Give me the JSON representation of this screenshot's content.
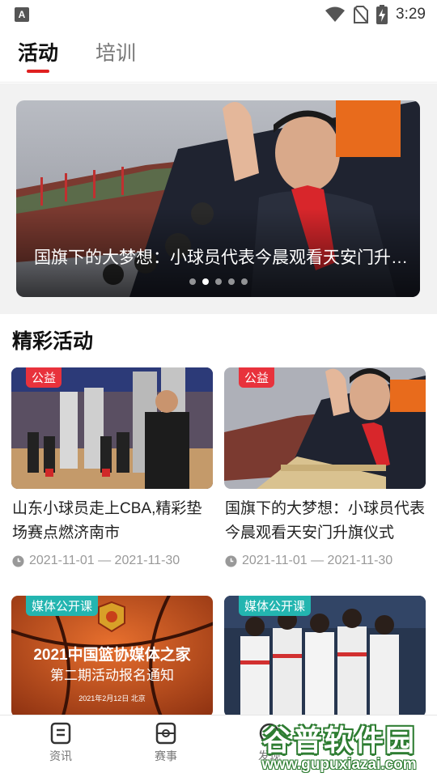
{
  "status_bar": {
    "time": "3:29"
  },
  "top_tabs": {
    "active": "活动",
    "inactive": "培训"
  },
  "banner": {
    "title": "国旗下的大梦想：小球员代表今晨观看天安门升旗仪式",
    "dots_total": 5,
    "active_dot": 1
  },
  "section": {
    "title": "精彩活动"
  },
  "cards": [
    {
      "badge": "公益",
      "title": "山东小球员走上CBA,精彩垫场赛点燃济南市",
      "date": "2021-11-01 — 2021-11-30"
    },
    {
      "badge": "公益",
      "title": "国旗下的大梦想：小球员代表今晨观看天安门升旗仪式",
      "date": "2021-11-01 — 2021-11-30"
    },
    {
      "badge": "媒体公开课",
      "poster_title": "2021中国篮协媒体之家",
      "poster_subtitle": "第二期活动报名通知",
      "poster_date": "2021年2月12日  北京"
    },
    {
      "badge": "媒体公开课"
    }
  ],
  "bottom_nav": {
    "items": [
      "资讯",
      "赛事",
      "发现"
    ]
  },
  "watermark": {
    "title": "谷普软件园",
    "url": "www.gupuxiazai.com"
  },
  "colors": {
    "accent": "#e02020",
    "badge_red": "#e8323c",
    "badge_teal": "#23b5b0"
  }
}
